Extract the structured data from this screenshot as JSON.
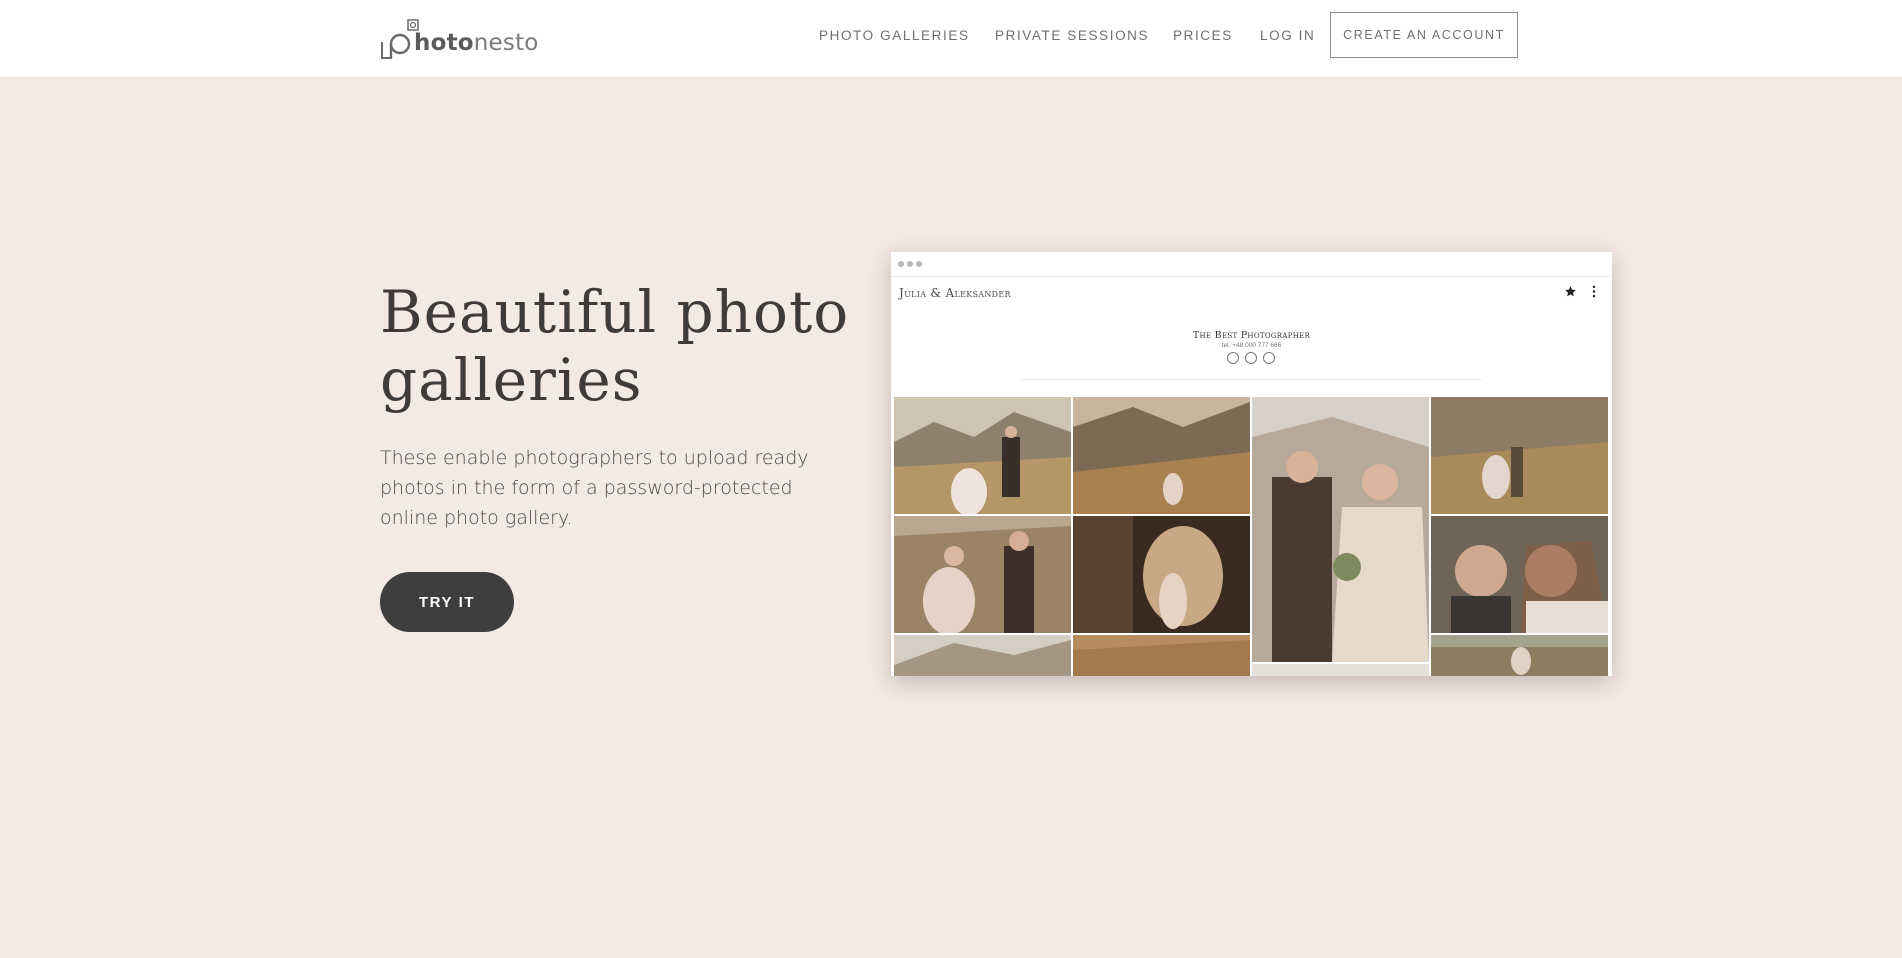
{
  "header": {
    "logo": {
      "name": "photonesto-logo",
      "text_bold": "hoto",
      "text_light": "nesto"
    },
    "nav": [
      {
        "label": "PHOTO GALLERIES"
      },
      {
        "label": "PRIVATE SESSIONS"
      },
      {
        "label": "PRICES"
      },
      {
        "label": "LOG IN"
      }
    ],
    "cta_label": "CREATE AN ACCOUNT"
  },
  "hero": {
    "title_line1": "Beautiful photo",
    "title_line2": "galleries",
    "description": "These enable photographers to upload ready photos in the form of a password-protected online photo gallery.",
    "button_label": "TRY IT"
  },
  "mockup": {
    "gallery_name": "Julia & Aleksander",
    "photographer": "The Best Photographer",
    "tel": "tel. +48 000 777 666",
    "icons": [
      "star-icon",
      "more-vertical-icon",
      "home-icon",
      "facebook-icon",
      "instagram-icon"
    ]
  },
  "colors": {
    "background": "#f3e9e5",
    "header_bg": "#ffffff",
    "button_bg": "#3f3e3e",
    "text_dark": "#3e3b3a",
    "nav_text": "#6f6f6f"
  }
}
